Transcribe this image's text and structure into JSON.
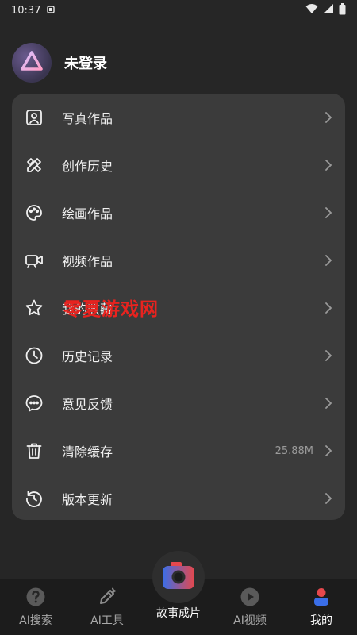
{
  "status_bar": {
    "time": "10:37",
    "icons": [
      "notification-icon",
      "wifi-icon",
      "signal-icon",
      "battery-icon"
    ]
  },
  "profile": {
    "username": "未登录",
    "avatar_icon": "triangle-logo-icon"
  },
  "menu": {
    "items": [
      {
        "label": "写真作品",
        "icon": "portrait-icon"
      },
      {
        "label": "创作历史",
        "icon": "pencil-ruler-icon"
      },
      {
        "label": "绘画作品",
        "icon": "palette-icon"
      },
      {
        "label": "视频作品",
        "icon": "video-camera-icon"
      },
      {
        "label": "我的收藏",
        "icon": "star-icon"
      },
      {
        "label": "历史记录",
        "icon": "clock-icon"
      },
      {
        "label": "意见反馈",
        "icon": "chat-bubble-icon"
      },
      {
        "label": "清除缓存",
        "icon": "trash-icon",
        "value": "25.88M"
      },
      {
        "label": "版本更新",
        "icon": "refresh-icon"
      }
    ]
  },
  "watermark": "零夏游戏网",
  "bottom_nav": {
    "items": [
      {
        "label": "AI搜索",
        "icon": "question-icon"
      },
      {
        "label": "AI工具",
        "icon": "pen-icon"
      },
      {
        "label": "故事成片",
        "icon": "camera-icon"
      },
      {
        "label": "AI视频",
        "icon": "play-icon"
      },
      {
        "label": "我的",
        "icon": "user-icon"
      }
    ],
    "active_index": 4
  },
  "colors": {
    "background": "#262626",
    "card": "#3b3b3b",
    "nav_bg": "#1c1c1c",
    "watermark": "#e8231f",
    "accent_blue": "#3a6ee8",
    "accent_red": "#e5484d"
  }
}
